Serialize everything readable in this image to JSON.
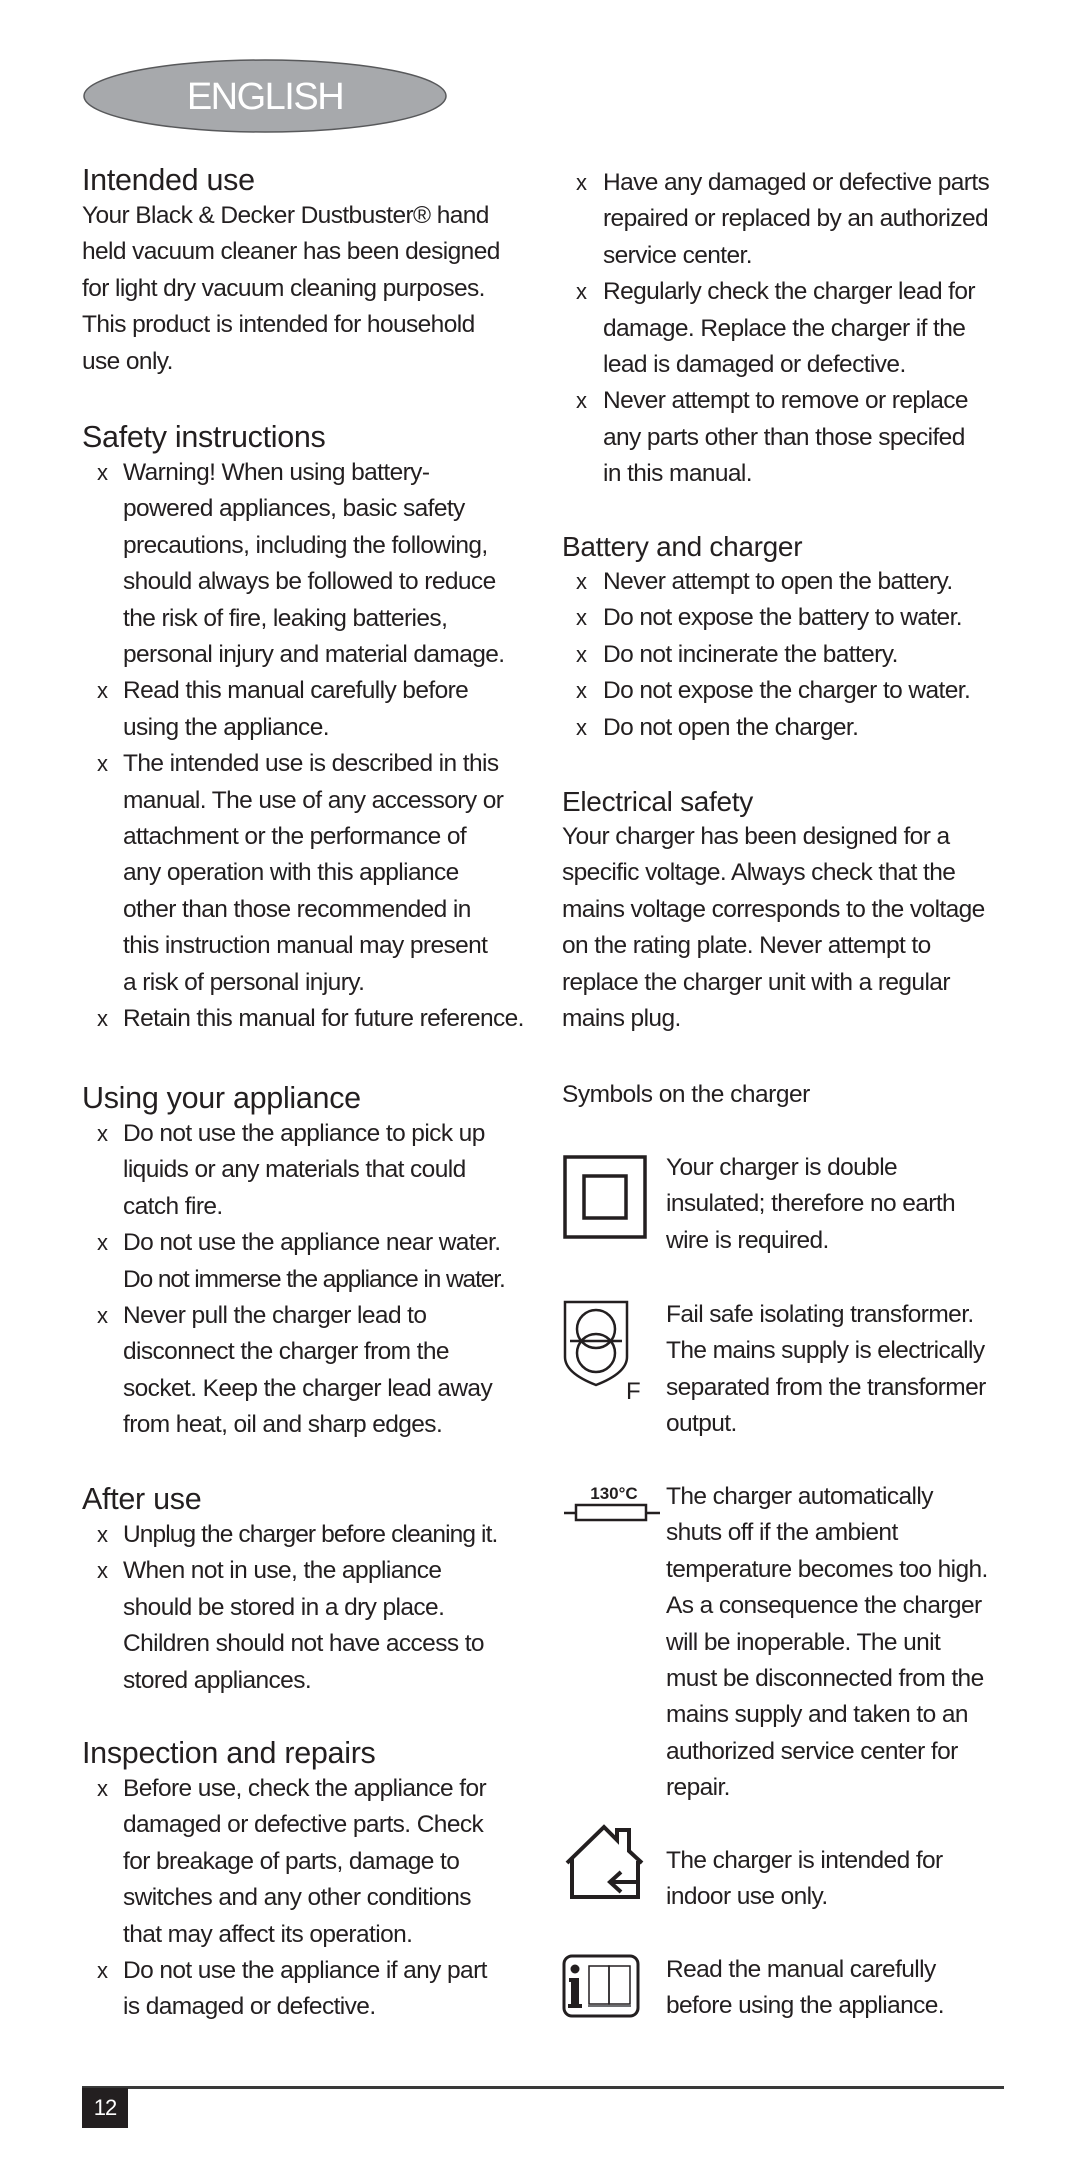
{
  "header": {
    "language_badge": "ENGLISH",
    "badge_color": "#a7a9ac"
  },
  "left_column": {
    "intended_use": {
      "heading": "Intended use",
      "body_lines": [
        "Your Black & Decker Dustbuster® hand",
        "held vacuum cleaner has been designed",
        "for light dry vacuum cleaning purposes.",
        "This product is intended for household",
        "use only."
      ]
    },
    "safety_instructions": {
      "heading": "Safety instructions",
      "bullet_mark": "x",
      "items": [
        {
          "lead": "Warning!",
          "lines": [
            " When using battery-",
            "powered appliances, basic safety",
            "precautions, including the following,",
            "should always be followed to reduce",
            "the risk of fire, leaking batteries,",
            "personal injury and material damage."
          ]
        },
        {
          "lines": [
            "Read this manual carefully before",
            "using the appliance."
          ]
        },
        {
          "lines": [
            "The intended use is described in this",
            "manual. The use of any accessory or",
            "attachment or the performance of",
            "any operation with this appliance",
            "other than those recommended in",
            "this instruction manual may present",
            "a risk of personal injury."
          ]
        },
        {
          "lines": [
            "Retain this manual for future reference."
          ]
        }
      ]
    },
    "using_your_appliance": {
      "heading": "Using your appliance",
      "items": [
        {
          "lines": [
            "Do not use the appliance to pick up",
            "liquids or any materials that could",
            "catch fire."
          ]
        },
        {
          "lines": [
            "Do not use the appliance near water.",
            "Do not immerse the appliance in water."
          ]
        },
        {
          "lines": [
            "Never pull the charger lead to",
            "disconnect the charger from the",
            "socket. Keep the charger lead away",
            "from heat, oil and sharp edges."
          ]
        }
      ]
    },
    "after_use": {
      "heading": "After use",
      "items": [
        {
          "lines": [
            "Unplug the charger before cleaning it."
          ]
        },
        {
          "lines": [
            "When not in use, the appliance",
            "should be stored in a dry place.",
            "Children should not have access to",
            "stored appliances."
          ]
        }
      ]
    },
    "inspection_and_repairs": {
      "heading": "Inspection and repairs",
      "items": [
        {
          "lines": [
            "Before use, check the appliance for",
            "damaged or defective parts. Check",
            "for breakage of parts, damage to",
            "switches and any other conditions",
            "that may affect its operation."
          ]
        },
        {
          "lines": [
            "Do not use the appliance if any part",
            "is damaged or defective."
          ]
        }
      ]
    }
  },
  "right_column": {
    "inspection_continued": {
      "items": [
        {
          "lines": [
            "Have any damaged or defective parts",
            "repaired or replaced by an authorized",
            "service center."
          ]
        },
        {
          "lines": [
            "Regularly check the charger lead for",
            "damage. Replace the charger if the",
            "lead is damaged or defective."
          ]
        },
        {
          "lines": [
            "Never attempt to remove or replace",
            "any parts other than those specifed",
            "in this manual."
          ]
        }
      ]
    },
    "battery_and_charger": {
      "heading": "Battery and charger",
      "items": [
        {
          "lines": [
            "Never attempt to open the battery."
          ]
        },
        {
          "lines": [
            "Do not expose the battery to water."
          ]
        },
        {
          "lines": [
            "Do not incinerate the battery."
          ]
        },
        {
          "lines": [
            "Do not expose the charger to water."
          ]
        },
        {
          "lines": [
            "Do not open the charger."
          ]
        }
      ]
    },
    "electrical_safety": {
      "heading": "Electrical safety",
      "body_lines": [
        "Your charger has been designed for a",
        "specific voltage. Always check that the",
        "mains voltage corresponds to the voltage",
        "on the rating plate. Never attempt to",
        "replace the charger unit with a regular",
        "mains plug."
      ]
    },
    "symbols": {
      "heading": "Symbols on the charger",
      "rows": [
        {
          "icon": "double-insulated-icon",
          "lines": [
            "Your charger is double",
            "insulated; therefore no earth",
            "wire is required."
          ]
        },
        {
          "icon": "isolating-transformer-icon",
          "icon_letter": "F",
          "lines": [
            "Fail safe isolating transformer.",
            "The mains supply is electrically",
            "separated from the transformer",
            "output."
          ]
        },
        {
          "icon": "thermal-fuse-icon",
          "icon_label": "130°C",
          "lines": [
            "The charger automatically",
            "shuts off if the ambient",
            "temperature becomes too high.",
            "As a consequence the charger",
            "will be inoperable. The unit",
            "must be disconnected from the",
            "mains supply and taken to an",
            "authorized service center for",
            "repair."
          ]
        },
        {
          "icon": "indoor-use-house-icon",
          "lines": [
            "The charger is intended for",
            "indoor use only."
          ]
        },
        {
          "icon": "read-manual-icon",
          "lines": [
            "Read the manual carefully",
            "before using the appliance."
          ]
        }
      ]
    }
  },
  "footer": {
    "page_number": "12"
  }
}
